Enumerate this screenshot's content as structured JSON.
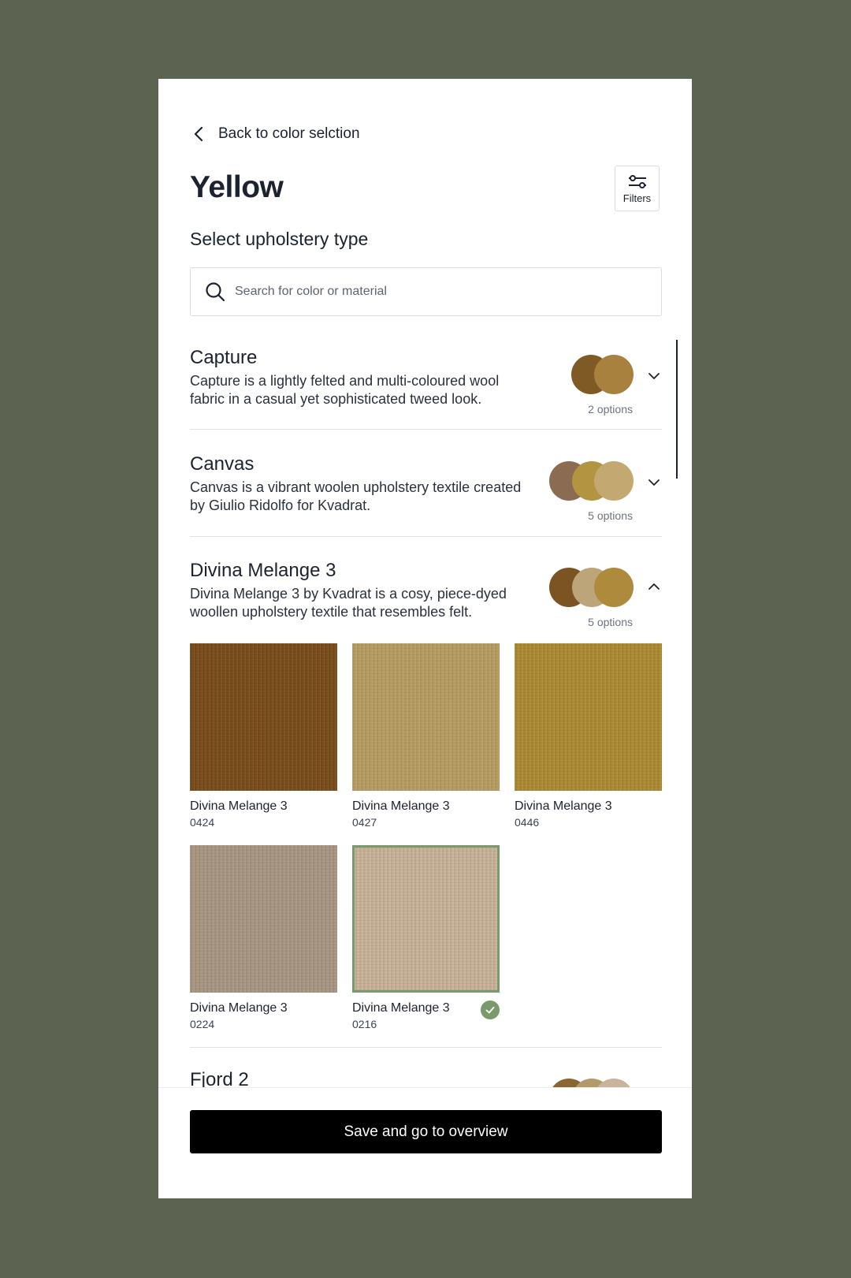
{
  "colors": {
    "background": "#5d6351",
    "selected_accent": "#7b9a6c",
    "primary_button": "#000000"
  },
  "header": {
    "back_label": "Back to color selction",
    "title": "Yellow",
    "filters_label": "Filters",
    "subtitle": "Select upholstery type"
  },
  "search": {
    "placeholder": "Search for color or material"
  },
  "materials": [
    {
      "name": "Capture",
      "description": "Capture is a lightly felted and multi-coloured wool fabric in a casual yet sophisticated tweed look.",
      "options_label": "2 options",
      "swatch_colors": [
        "#7f5a24",
        "#a7813d"
      ],
      "expanded": false
    },
    {
      "name": "Canvas",
      "description": "Canvas is a vibrant woolen upholstery textile created by Giulio Ridolfo for Kvadrat.",
      "options_label": "5 options",
      "swatch_colors": [
        "#8b6b52",
        "#b39441",
        "#c4a871"
      ],
      "expanded": false
    },
    {
      "name": "Divina Melange 3",
      "description": "Divina Melange 3 by Kvadrat is a cosy, piece-dyed woollen upholstery textile that resembles felt.",
      "options_label": "5 options",
      "swatch_colors": [
        "#7c5424",
        "#bda57a",
        "#ad8a3c"
      ],
      "expanded": true,
      "swatches": [
        {
          "name": "Divina Melange 3",
          "code": "0424",
          "color": "#7b4e1c",
          "selected": false
        },
        {
          "name": "Divina Melange 3",
          "code": "0427",
          "color": "#b89d63",
          "selected": false
        },
        {
          "name": "Divina Melange 3",
          "code": "0446",
          "color": "#ad8a34",
          "selected": false
        },
        {
          "name": "Divina Melange 3",
          "code": "0224",
          "color": "#a99783",
          "selected": false
        },
        {
          "name": "Divina Melange 3",
          "code": "0216",
          "color": "#c8b299",
          "selected": true
        }
      ]
    },
    {
      "name": "Fjord 2",
      "swatch_colors": [
        "#8a6630",
        "#b29a6d",
        "#c7b49a"
      ]
    }
  ],
  "footer": {
    "save_label": "Save and go to overview"
  }
}
